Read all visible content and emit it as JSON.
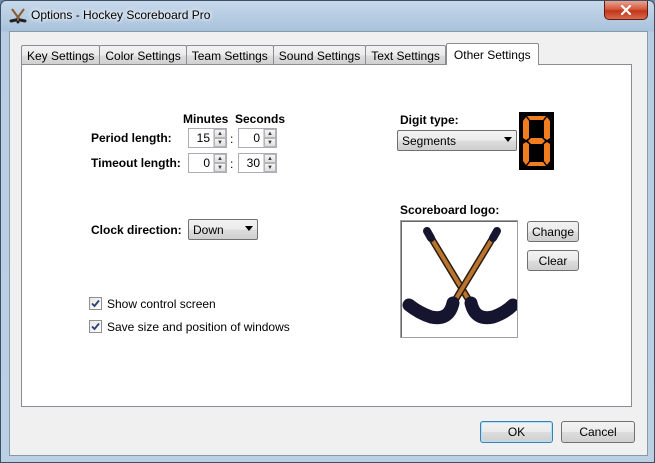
{
  "window": {
    "title": "Options - Hockey Scoreboard Pro"
  },
  "tabs": [
    {
      "label": "Key Settings",
      "active": false
    },
    {
      "label": "Color Settings",
      "active": false
    },
    {
      "label": "Team Settings",
      "active": false
    },
    {
      "label": "Sound Settings",
      "active": false
    },
    {
      "label": "Text Settings",
      "active": false
    },
    {
      "label": "Other Settings",
      "active": true
    }
  ],
  "timing": {
    "minutes_header": "Minutes",
    "seconds_header": "Seconds",
    "separator": ":",
    "period": {
      "label": "Period length:",
      "minutes": "15",
      "seconds": "0"
    },
    "timeout": {
      "label": "Timeout length:",
      "minutes": "0",
      "seconds": "30"
    }
  },
  "clock_direction": {
    "label": "Clock direction:",
    "value": "Down"
  },
  "digit_type": {
    "label": "Digit type:",
    "value": "Segments",
    "preview_digit": "8",
    "preview_color": "#f07d1e"
  },
  "scoreboard_logo": {
    "label": "Scoreboard logo:",
    "change_label": "Change",
    "clear_label": "Clear"
  },
  "options": {
    "show_control_screen": {
      "label": "Show control screen",
      "checked": true
    },
    "save_size_position": {
      "label": "Save size and position of windows",
      "checked": true
    }
  },
  "footer": {
    "ok_label": "OK",
    "cancel_label": "Cancel"
  }
}
